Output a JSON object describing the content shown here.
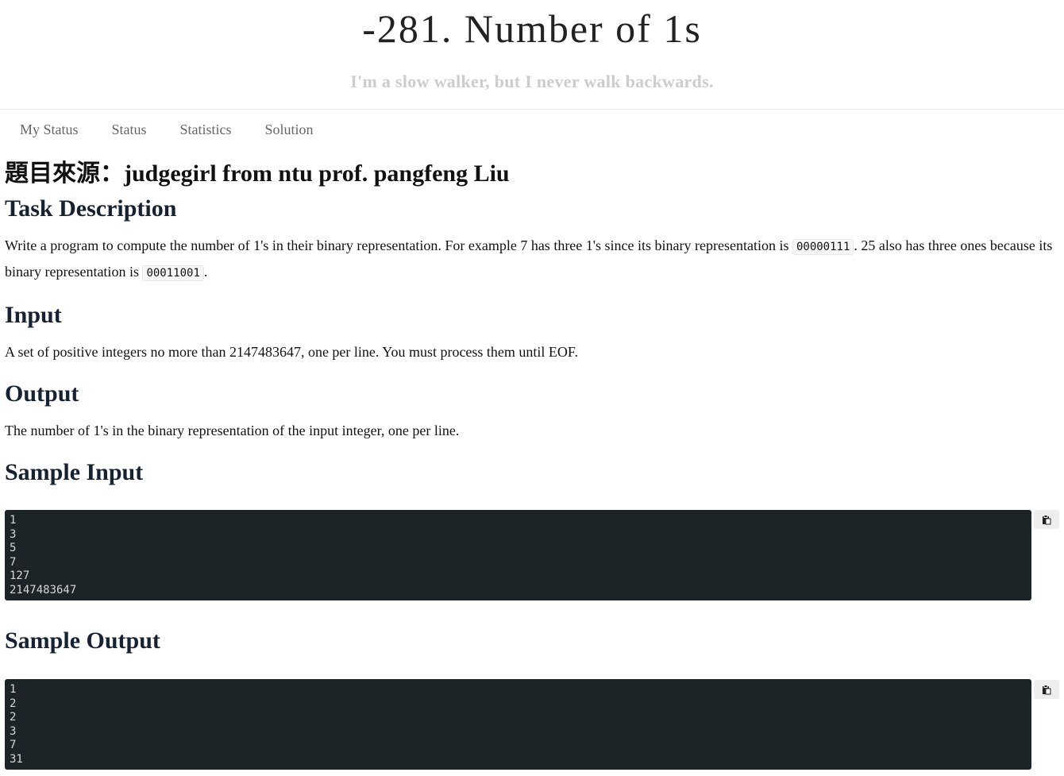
{
  "header": {
    "title": "-281. Number of 1s",
    "subtitle": "I'm a slow walker, but I never walk backwards."
  },
  "nav": [
    {
      "label": "My Status"
    },
    {
      "label": "Status"
    },
    {
      "label": "Statistics"
    },
    {
      "label": "Solution"
    }
  ],
  "content": {
    "source": "題目來源：judgegirl from ntu prof. pangfeng Liu",
    "task": {
      "heading": "Task Description",
      "text_1": "Write a program to compute the number of 1's in their binary representation. For example 7 has three 1's since its binary representation is ",
      "code_1": "00000111",
      "text_2": ". 25 also has three ones because its binary representation is ",
      "code_2": "00011001",
      "text_3": "."
    },
    "input": {
      "heading": "Input",
      "text": "A set of positive integers no more than 2147483647, one per line. You must process them until EOF."
    },
    "output": {
      "heading": "Output",
      "text": "The number of 1's in the binary representation of the input integer, one per line."
    },
    "sample_input": {
      "heading": "Sample Input",
      "lines": [
        "1",
        "3",
        "5",
        "7",
        "127",
        "2147483647"
      ]
    },
    "sample_output": {
      "heading": "Sample Output",
      "lines": [
        "1",
        "2",
        "2",
        "3",
        "7",
        "31"
      ]
    }
  },
  "icons": {
    "copy": "clipboard-icon"
  }
}
